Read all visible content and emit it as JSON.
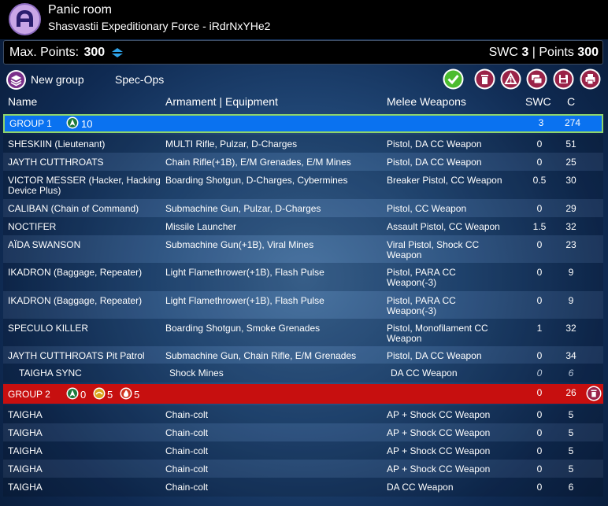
{
  "header": {
    "title": "Panic room",
    "subtitle": "Shasvastii Expeditionary Force - iRdrNxYHe2"
  },
  "points_bar": {
    "max_label": "Max. Points:",
    "max_value": "300",
    "swc_label": "SWC",
    "swc_value": "3",
    "separator": "|",
    "points_label": "Points",
    "points_value": "300"
  },
  "toolbar": {
    "new_group_label": "New group",
    "spec_ops_label": "Spec-Ops",
    "icons": [
      "check-icon",
      "trash-icon",
      "alert-icon",
      "chat-icon",
      "save-icon",
      "print-icon"
    ]
  },
  "columns": {
    "name": "Name",
    "armament": "Armament | Equipment",
    "melee": "Melee Weapons",
    "swc": "SWC",
    "c": "C"
  },
  "group1": {
    "name": "GROUP 1",
    "orders_regular": "10",
    "swc": "3",
    "c": "274",
    "units": [
      {
        "name": "SHESKIIN (Lieutenant)",
        "armament": "MULTI Rifle, Pulzar, D-Charges",
        "melee": "Pistol, DA CC Weapon",
        "swc": "0",
        "c": "51"
      },
      {
        "name": "JAYTH CUTTHROATS",
        "armament": "Chain Rifle(+1B), E/M Grenades, E/M Mines",
        "melee": "Pistol, DA CC Weapon",
        "swc": "0",
        "c": "25"
      },
      {
        "name": "VICTOR MESSER (Hacker, Hacking Device Plus)",
        "armament": "Boarding Shotgun, D-Charges, Cybermines",
        "melee": "Breaker Pistol, CC Weapon",
        "swc": "0.5",
        "c": "30"
      },
      {
        "name": "CALIBAN (Chain of Command)",
        "armament": "Submachine Gun, Pulzar, D-Charges",
        "melee": "Pistol, CC Weapon",
        "swc": "0",
        "c": "29"
      },
      {
        "name": "NOCTIFER",
        "armament": "Missile Launcher",
        "melee": "Assault Pistol, CC Weapon",
        "swc": "1.5",
        "c": "32"
      },
      {
        "name": "AÏDA SWANSON",
        "armament": "Submachine Gun(+1B), Viral Mines",
        "melee": "Viral Pistol, Shock CC Weapon",
        "swc": "0",
        "c": "23"
      },
      {
        "name": "IKADRON (Baggage, Repeater)",
        "armament": "Light Flamethrower(+1B), Flash Pulse",
        "melee": "Pistol, PARA CC Weapon(-3)",
        "swc": "0",
        "c": "9"
      },
      {
        "name": "IKADRON (Baggage, Repeater)",
        "armament": "Light Flamethrower(+1B), Flash Pulse",
        "melee": "Pistol, PARA CC Weapon(-3)",
        "swc": "0",
        "c": "9"
      },
      {
        "name": "SPECULO KILLER",
        "armament": "Boarding Shotgun, Smoke Grenades",
        "melee": "Pistol, Monofilament CC Weapon",
        "swc": "1",
        "c": "32"
      },
      {
        "name": "JAYTH CUTTHROATS Pit Patrol",
        "armament": "Submachine Gun, Chain Rifle, E/M Grenades",
        "melee": "Pistol, DA CC Weapon",
        "swc": "0",
        "c": "34"
      },
      {
        "name": "TAIGHA SYNC",
        "armament": "Shock Mines",
        "melee": "DA CC Weapon",
        "swc": "0",
        "c": "6"
      }
    ]
  },
  "group2": {
    "name": "GROUP 2",
    "orders_regular": "0",
    "orders_irregular": "5",
    "orders_impetuous": "5",
    "swc": "0",
    "c": "26",
    "units": [
      {
        "name": "TAIGHA",
        "armament": "Chain-colt",
        "melee": "AP + Shock CC Weapon",
        "swc": "0",
        "c": "5"
      },
      {
        "name": "TAIGHA",
        "armament": "Chain-colt",
        "melee": "AP + Shock CC Weapon",
        "swc": "0",
        "c": "5"
      },
      {
        "name": "TAIGHA",
        "armament": "Chain-colt",
        "melee": "AP + Shock CC Weapon",
        "swc": "0",
        "c": "5"
      },
      {
        "name": "TAIGHA",
        "armament": "Chain-colt",
        "melee": "AP + Shock CC Weapon",
        "swc": "0",
        "c": "5"
      },
      {
        "name": "TAIGHA",
        "armament": "Chain-colt",
        "melee": "DA CC Weapon",
        "swc": "0",
        "c": "6"
      }
    ]
  },
  "colors": {
    "group1_bg": "#0a72f0",
    "group1_border": "#8fd46a",
    "group2_bg": "#c70f0f",
    "regular_order": "#1e7a3c",
    "irregular_order": "#d9a21a",
    "impetuous_order": "#d0351f"
  }
}
